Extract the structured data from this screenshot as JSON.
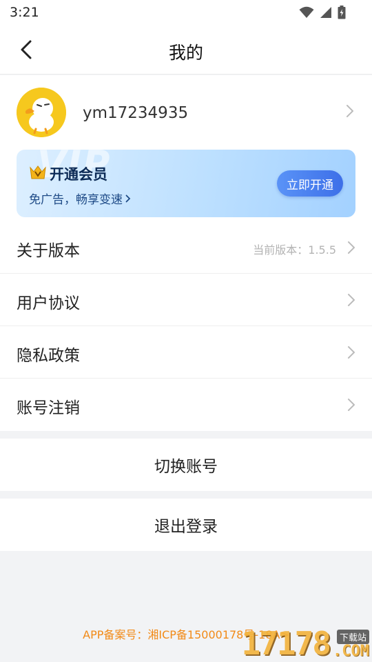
{
  "status_bar": {
    "time": "3:21"
  },
  "header": {
    "title": "我的"
  },
  "profile": {
    "username": "ym17234935"
  },
  "vip": {
    "watermark": "VIP",
    "title": "开通会员",
    "subtitle": "免广告，畅享变速",
    "button_label": "立即开通",
    "accent": "#4a7ff0"
  },
  "menu": [
    {
      "label": "关于版本",
      "value": "当前版本：1.5.5"
    },
    {
      "label": "用户协议"
    },
    {
      "label": "隐私政策"
    },
    {
      "label": "账号注销"
    }
  ],
  "actions": {
    "switch_account": "切换账号",
    "logout": "退出登录"
  },
  "footer": {
    "icp": "APP备案号：湘ICP备15000178号-18A>"
  },
  "watermark": {
    "digits": "17178",
    "tag": "下载站",
    "domain": ".COM"
  }
}
